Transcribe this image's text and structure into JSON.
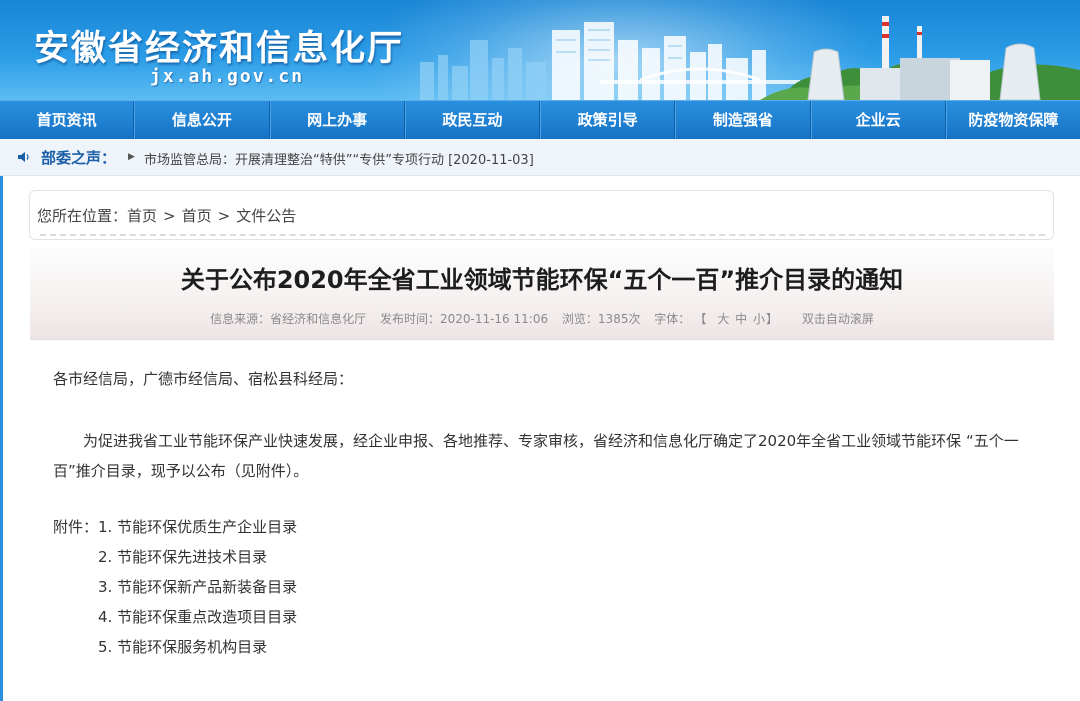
{
  "site": {
    "title": "安徽省经济和信息化厅",
    "domain": "jx.ah.gov.cn"
  },
  "nav": [
    "首页资讯",
    "信息公开",
    "网上办事",
    "政民互动",
    "政策引导",
    "制造强省",
    "企业云",
    "防疫物资保障"
  ],
  "notice": {
    "label": "部委之声：",
    "text": "市场监管总局：开展清理整治“特供”“专供”专项行动 [2020-11-03]"
  },
  "breadcrumb": {
    "prefix": "您所在位置：",
    "items": [
      "首页",
      "首页",
      "文件公告"
    ]
  },
  "article": {
    "title": "关于公布2020年全省工业领域节能环保“五个一百”推介目录的通知",
    "meta": {
      "source": "信息来源：省经济和信息化厅",
      "published": "发布时间：2020-11-16 11:06",
      "views": "浏览：1385次",
      "font_label": "字体：",
      "font_open": "【",
      "font_large": "大",
      "font_medium": "中",
      "font_small": "小",
      "font_close": "】",
      "autoscroll": "双击自动滚屏"
    },
    "salutation": "各市经信局，广德市经信局、宿松县科经局：",
    "paragraph": "为促进我省工业节能环保产业快速发展，经企业申报、各地推荐、专家审核，省经济和信息化厅确定了2020年全省工业领域节能环保 “五个一百”推介目录，现予以公布（见附件）。",
    "attachments_label": "附件：",
    "attachments": [
      "1. 节能环保优质生产企业目录",
      "2. 节能环保先进技术目录",
      "3. 节能环保新产品新装备目录",
      "4. 节能环保重点改造项目目录",
      "5. 节能环保服务机构目录"
    ]
  },
  "colors": {
    "banner_blue": "#2a9be6",
    "nav_blue": "#1673c6",
    "notice_label": "#1b5fa8"
  }
}
